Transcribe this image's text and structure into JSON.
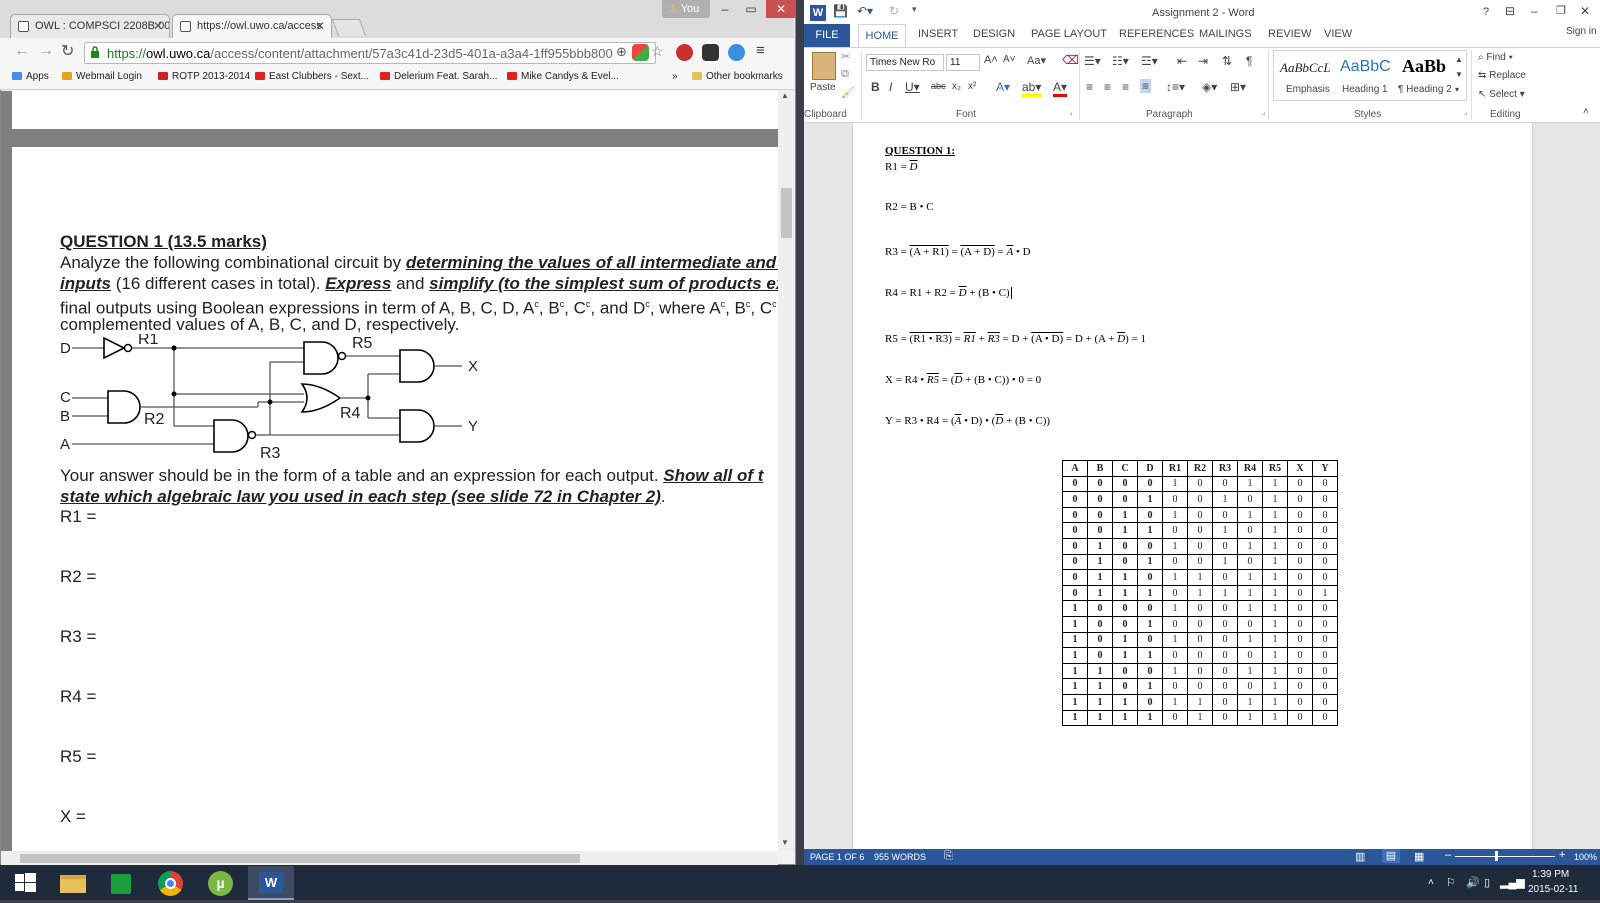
{
  "chrome": {
    "tabs": [
      {
        "title": "OWL : COMPSCI 2208B 00"
      },
      {
        "title": "https://owl.uwo.ca/access"
      }
    ],
    "profile_badge": "You",
    "url_prefix": "https://",
    "url_host": "owl.uwo.ca",
    "url_path": "/access/content/attachment/57a3c41d-23d5-401a-a3a4-1ff955bbb800",
    "bookmarks": [
      {
        "label": "Apps",
        "icon": "apps-grid-icon",
        "color": "#4a8af4"
      },
      {
        "label": "Webmail Login",
        "icon": "western-logo-icon",
        "color": "#e6a21f"
      },
      {
        "label": "ROTP 2013-2014",
        "icon": "maple-leaf-icon",
        "color": "#cc2222"
      },
      {
        "label": "East Clubbers - Sext...",
        "icon": "youtube-icon",
        "color": "#e02020"
      },
      {
        "label": "Delerium Feat. Sarah...",
        "icon": "youtube-icon",
        "color": "#e02020"
      },
      {
        "label": "Mike Candys & Evel...",
        "icon": "youtube-icon",
        "color": "#e02020"
      }
    ],
    "bookmarks_overflow": "»",
    "other_bookmarks": "Other bookmarks"
  },
  "pdf": {
    "q_heading": "QUESTION 1 (13.5 marks)",
    "line1_a": "Analyze the following combinational circuit by ",
    "line1_b": "determining the values of all intermediate and fi",
    "line2_a": "inputs",
    "line2_b": " (16 different cases in total). ",
    "line2_c": "Express",
    "line2_d": " and ",
    "line2_e": "simplify (to the simplest sum of products express",
    "line3": "final outputs using Boolean expressions in term of A, B, C, D, A",
    "line3_sup": "c",
    "line3_b": ", B",
    "line3_c": ", C",
    "line3_d": ", and D",
    "line3_e": ", where A",
    "line3_f": ", B",
    "line3_g": ", C",
    "line4": "complemented values of  A, B, C, and D, respectively.",
    "circuit_labels": {
      "d": "D",
      "c": "C",
      "b": "B",
      "a": "A",
      "r1": "R1",
      "r2": "R2",
      "r3": "R3",
      "r4": "R4",
      "r5": "R5",
      "x": "X",
      "y": "Y"
    },
    "answer_a": "Your answer should be in the form of a table and an expression for each output. ",
    "answer_b": "Show all of t",
    "answer_c": "state which algebraic law you used in each step (see slide 72 in Chapter 2)",
    "answer_d": ".",
    "fields": [
      "R1 =",
      "R2 =",
      "R3 =",
      "R4 =",
      "R5 =",
      "X ="
    ]
  },
  "word": {
    "window_title": "Assignment 2 - Word",
    "help": "?",
    "sign_in": "Sign in",
    "tabs": [
      "FILE",
      "HOME",
      "INSERT",
      "DESIGN",
      "PAGE LAYOUT",
      "REFERENCES",
      "MAILINGS",
      "REVIEW",
      "VIEW"
    ],
    "font_name": "Times New Ro",
    "font_size": "11",
    "paste_label": "Paste",
    "groups": [
      "Clipboard",
      "Font",
      "Paragraph",
      "Styles",
      "Editing"
    ],
    "styles": [
      {
        "sample": "AaBbCcL",
        "name": "Emphasis"
      },
      {
        "sample": "AaBbC",
        "name": "Heading 1"
      },
      {
        "sample": "AaBb",
        "name": "¶ Heading 2"
      }
    ],
    "editing": [
      "Find",
      "Replace",
      "Select"
    ],
    "doc": {
      "heading": "QUESTION 1:",
      "r1_label": "R1 = ",
      "r1_bar": "D",
      "r2": "R2 = B • C",
      "r3_a": "R3 = ",
      "r3_b": "(A + R1)",
      "r3_c": " = ",
      "r3_d": "(A + D)",
      "r3_e": " = ",
      "r3_f": "A",
      "r3_g": " • D",
      "r4_a": "R4 = R1 + R2 = ",
      "r4_b": "D",
      "r4_c": " + (B • C)",
      "r5_a": "R5 = ",
      "r5_b": "(R1 • R3)",
      "r5_c": " = ",
      "r5_d": "R1",
      "r5_e": " + ",
      "r5_f": "R3",
      "r5_g": " = D + ",
      "r5_h": "(A • D)",
      "r5_i": " = D + (A + ",
      "r5_j": "D",
      "r5_k": ") = 1",
      "x_a": "X = R4 • ",
      "x_b": "R5",
      "x_c": " = (",
      "x_d": "D",
      "x_e": " + (B • C)) • 0 = 0",
      "y_a": "Y = R3 • R4 = (",
      "y_b": "A",
      "y_c": " • D) • (",
      "y_d": "D",
      "y_e": " + (B • C))"
    },
    "table": {
      "headers": [
        "A",
        "B",
        "C",
        "D",
        "R1",
        "R2",
        "R3",
        "R4",
        "R5",
        "X",
        "Y"
      ],
      "rows": [
        [
          "0",
          "0",
          "0",
          "0",
          "1",
          "0",
          "0",
          "1",
          "1",
          "0",
          "0"
        ],
        [
          "0",
          "0",
          "0",
          "1",
          "0",
          "0",
          "1",
          "0",
          "1",
          "0",
          "0"
        ],
        [
          "0",
          "0",
          "1",
          "0",
          "1",
          "0",
          "0",
          "1",
          "1",
          "0",
          "0"
        ],
        [
          "0",
          "0",
          "1",
          "1",
          "0",
          "0",
          "1",
          "0",
          "1",
          "0",
          "0"
        ],
        [
          "0",
          "1",
          "0",
          "0",
          "1",
          "0",
          "0",
          "1",
          "1",
          "0",
          "0"
        ],
        [
          "0",
          "1",
          "0",
          "1",
          "0",
          "0",
          "1",
          "0",
          "1",
          "0",
          "0"
        ],
        [
          "0",
          "1",
          "1",
          "0",
          "1",
          "1",
          "0",
          "1",
          "1",
          "0",
          "0"
        ],
        [
          "0",
          "1",
          "1",
          "1",
          "0",
          "1",
          "1",
          "1",
          "1",
          "0",
          "1"
        ],
        [
          "1",
          "0",
          "0",
          "0",
          "1",
          "0",
          "0",
          "1",
          "1",
          "0",
          "0"
        ],
        [
          "1",
          "0",
          "0",
          "1",
          "0",
          "0",
          "0",
          "0",
          "1",
          "0",
          "0"
        ],
        [
          "1",
          "0",
          "1",
          "0",
          "1",
          "0",
          "0",
          "1",
          "1",
          "0",
          "0"
        ],
        [
          "1",
          "0",
          "1",
          "1",
          "0",
          "0",
          "0",
          "0",
          "1",
          "0",
          "0"
        ],
        [
          "1",
          "1",
          "0",
          "0",
          "1",
          "0",
          "0",
          "1",
          "1",
          "0",
          "0"
        ],
        [
          "1",
          "1",
          "0",
          "1",
          "0",
          "0",
          "0",
          "0",
          "1",
          "0",
          "0"
        ],
        [
          "1",
          "1",
          "1",
          "0",
          "1",
          "1",
          "0",
          "1",
          "1",
          "0",
          "0"
        ],
        [
          "1",
          "1",
          "1",
          "1",
          "0",
          "1",
          "0",
          "1",
          "1",
          "0",
          "0"
        ]
      ]
    },
    "status": {
      "page": "PAGE 1 OF 6",
      "words": "955 WORDS",
      "zoom": "100%"
    }
  },
  "taskbar": {
    "time": "1:39 PM",
    "date": "2015-02-11",
    "apps": [
      "start-button",
      "file-explorer-icon",
      "store-icon",
      "chrome-icon",
      "utorrent-icon",
      "word-icon"
    ]
  }
}
